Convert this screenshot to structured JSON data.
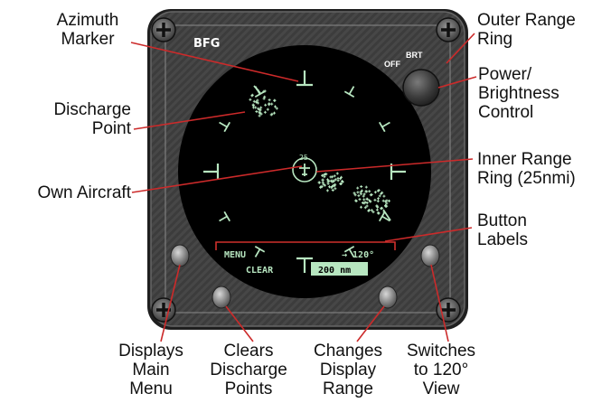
{
  "instrument": {
    "brand": "BFG",
    "brt_label": "BRT",
    "off_label": "OFF",
    "range_ring_label": "25",
    "button_labels": {
      "menu": "MENU",
      "view": "→ 120°",
      "clear": "CLEAR",
      "range": "200 nm"
    }
  },
  "callouts": {
    "azimuth_marker": [
      "Azimuth",
      "Marker"
    ],
    "discharge_point": [
      "Discharge",
      "Point"
    ],
    "own_aircraft": [
      "Own Aircraft"
    ],
    "outer_range_ring": [
      "Outer Range",
      "Ring"
    ],
    "power_brightness": [
      "Power/",
      "Brightness",
      "Control"
    ],
    "inner_range_ring": [
      "Inner Range",
      "Ring (25nmi)"
    ],
    "button_labels": [
      "Button",
      "Labels"
    ],
    "displays_main_menu": [
      "Displays",
      "Main",
      "Menu"
    ],
    "clears_discharge_points": [
      "Clears",
      "Discharge",
      "Points"
    ],
    "changes_display_range": [
      "Changes",
      "Display",
      "Range"
    ],
    "switches_view": [
      "Switches",
      "to 120°",
      "View"
    ]
  },
  "colors": {
    "screen": "#000000",
    "display_green": "#b7e6c0",
    "label_red": "#d0302c",
    "bezel": "#3a3a3a",
    "callout_line": "#cc2a2a"
  }
}
